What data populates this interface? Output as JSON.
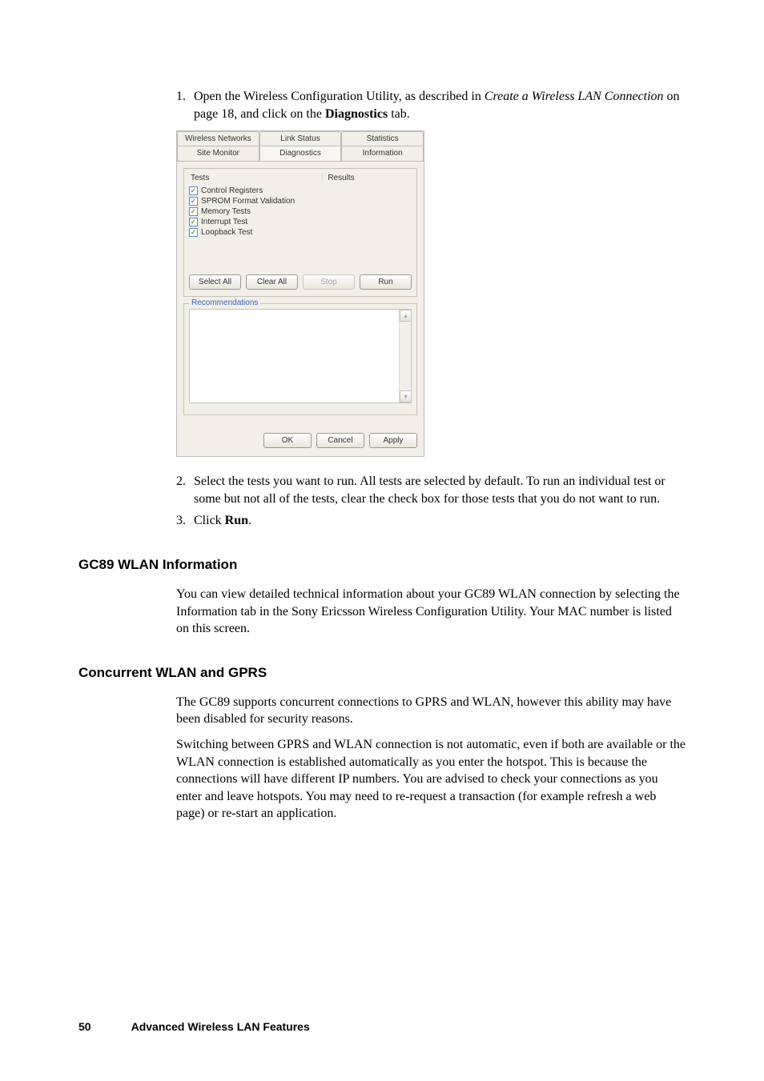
{
  "steps": {
    "s1": {
      "num": "1.",
      "pre": "Open the Wireless Configuration Utility, as described in ",
      "link": "Create a Wireless LAN Connection",
      "mid": " on page 18, and click on the ",
      "bold": "Diagnostics",
      "post": " tab."
    },
    "s2": {
      "num": "2.",
      "text": "Select the tests you want to run. All tests are selected by default. To run an individual test or some but not all of the tests, clear the check box for those tests that you do not want to run."
    },
    "s3": {
      "num": "3.",
      "pre": "Click ",
      "bold": "Run",
      "post": "."
    }
  },
  "dialog": {
    "tabs": {
      "wireless": "Wireless Networks",
      "link": "Link Status",
      "stats": "Statistics",
      "site": "Site Monitor",
      "diag": "Diagnostics",
      "info": "Information"
    },
    "tests_label": "Tests",
    "results_label": "Results",
    "items": {
      "t0": "Control Registers",
      "t1": "SPROM Format Validation",
      "t2": "Memory Tests",
      "t3": "Interrupt Test",
      "t4": "Loopback Test"
    },
    "buttons": {
      "select_all": "Select All",
      "clear_all": "Clear All",
      "stop": "Stop",
      "run": "Run",
      "ok": "OK",
      "cancel": "Cancel",
      "apply": "Apply"
    },
    "rec_label": "Recommendations"
  },
  "sections": {
    "h1": "GC89 WLAN Information",
    "p1": "You can view detailed technical information about your GC89 WLAN connection by selecting the Information tab in the Sony Ericsson Wireless Configuration Utility. Your MAC number is listed on this screen.",
    "h2": "Concurrent WLAN and GPRS",
    "p2": "The GC89 supports concurrent connections to GPRS and WLAN, however this ability may have been disabled for security reasons.",
    "p3": "Switching between GPRS and WLAN connection is not automatic, even if both are available or the WLAN connection is established automatically as you enter the hotspot. This is because the connections will have different IP numbers. You are advised to check your connections as you enter and leave hotspots. You may need to re-request a transaction (for example refresh a web page) or re-start an application."
  },
  "footer": {
    "page": "50",
    "title": "Advanced Wireless LAN Features"
  }
}
